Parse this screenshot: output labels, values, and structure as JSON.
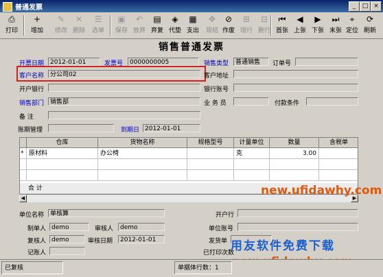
{
  "window": {
    "title": "普通发票",
    "controls": {
      "minimize": "_",
      "restore": "□",
      "close": "×"
    }
  },
  "toolbar": {
    "items": [
      {
        "label": "打印",
        "icon": "printer-icon",
        "glyph": "⎙",
        "enabled": true
      },
      {
        "label": "增加",
        "icon": "add-icon",
        "glyph": "+",
        "enabled": true
      },
      {
        "label": "修改",
        "icon": "edit-icon",
        "glyph": "✎",
        "enabled": false
      },
      {
        "label": "删除",
        "icon": "delete-icon",
        "glyph": "✕",
        "enabled": false
      },
      {
        "label": "选单",
        "icon": "select-icon",
        "glyph": "☰",
        "enabled": false
      },
      {
        "label": "保存",
        "icon": "save-icon",
        "glyph": "▣",
        "enabled": false
      },
      {
        "label": "放弃",
        "icon": "discard-icon",
        "glyph": "↶",
        "enabled": false
      },
      {
        "label": "弃复",
        "icon": "review-icon",
        "glyph": "▤",
        "enabled": true
      },
      {
        "label": "代垫",
        "icon": "advance-icon",
        "glyph": "◈",
        "enabled": true
      },
      {
        "label": "支出",
        "icon": "expense-icon",
        "glyph": "▦",
        "enabled": true
      },
      {
        "label": "现结",
        "icon": "settle-icon",
        "glyph": "✥",
        "enabled": false
      },
      {
        "label": "作废",
        "icon": "void-icon",
        "glyph": "⊘",
        "enabled": true
      },
      {
        "label": "增行",
        "icon": "add-row-icon",
        "glyph": "⊞",
        "enabled": false
      },
      {
        "label": "删行",
        "icon": "delete-row-icon",
        "glyph": "⊟",
        "enabled": false
      },
      {
        "label": "首张",
        "icon": "first-icon",
        "glyph": "⏮",
        "enabled": true
      },
      {
        "label": "上张",
        "icon": "prev-icon",
        "glyph": "◀",
        "enabled": true
      },
      {
        "label": "下张",
        "icon": "next-icon",
        "glyph": "▶",
        "enabled": true
      },
      {
        "label": "末张",
        "icon": "last-icon",
        "glyph": "⏭",
        "enabled": true
      },
      {
        "label": "定位",
        "icon": "locate-icon",
        "glyph": "⌖",
        "enabled": true
      },
      {
        "label": "刷新",
        "icon": "refresh-icon",
        "glyph": "⟳",
        "enabled": true
      }
    ]
  },
  "form": {
    "title": "销售普通发票",
    "invoice_date_label": "开票日期",
    "invoice_date": "2012-01-01",
    "invoice_no_label": "发票号",
    "invoice_no": "0000000005",
    "sales_type_label": "销售类型",
    "sales_type": "普通销售",
    "order_no_label": "订单号",
    "order_no": "",
    "customer_name_label": "客户名称",
    "customer_name": "分公司02",
    "customer_address_label": "客户地址",
    "customer_address": "",
    "bank_label": "开户银行",
    "bank": "",
    "account_label": "银行账号",
    "account": "",
    "department_label": "销售部门",
    "department": "销售部",
    "salesperson_label": "业 务 员",
    "salesperson": "",
    "payment_terms_label": "付款条件",
    "payment_terms": "",
    "remark_label": "备    注",
    "remark": "",
    "account_mgmt_label": "账期管理",
    "account_mgmt": "",
    "due_date_label": "到期日",
    "due_date": "2012-01-01"
  },
  "grid": {
    "columns": [
      "仓库",
      "货物名称",
      "规格型号",
      "计量单位",
      "数量",
      "含税单"
    ],
    "rows": [
      {
        "marker": "*",
        "warehouse": "原材料",
        "name": "办公椅",
        "spec": "",
        "unit": "克",
        "qty": "3.00",
        "price": ""
      }
    ],
    "total_label": "合  计"
  },
  "footer": {
    "unit_name_label": "单位名称",
    "unit_name": "单核算",
    "bank_label": "开户行",
    "bank": "",
    "maker_label": "制单人",
    "maker": "demo",
    "auditor_label": "审核人",
    "auditor": "demo",
    "unit_account_label": "单位账号",
    "unit_account": "",
    "reviewer_label": "复核人",
    "reviewer": "demo",
    "audit_date_label": "审核日期",
    "audit_date": "2012-01-01",
    "shipper_label": "发货单",
    "shipper": "",
    "bookkeeper_label": "记账人",
    "bookkeeper": "",
    "printed_label": "已打印次数",
    "printed": ""
  },
  "status": {
    "state": "已复核",
    "lines_label": "单据体行数：1"
  },
  "watermark": {
    "url_top": "new.ufidawhy.com",
    "slogan": "用友软件免费下载",
    "url_bottom": "new.ufidawhy.com"
  }
}
